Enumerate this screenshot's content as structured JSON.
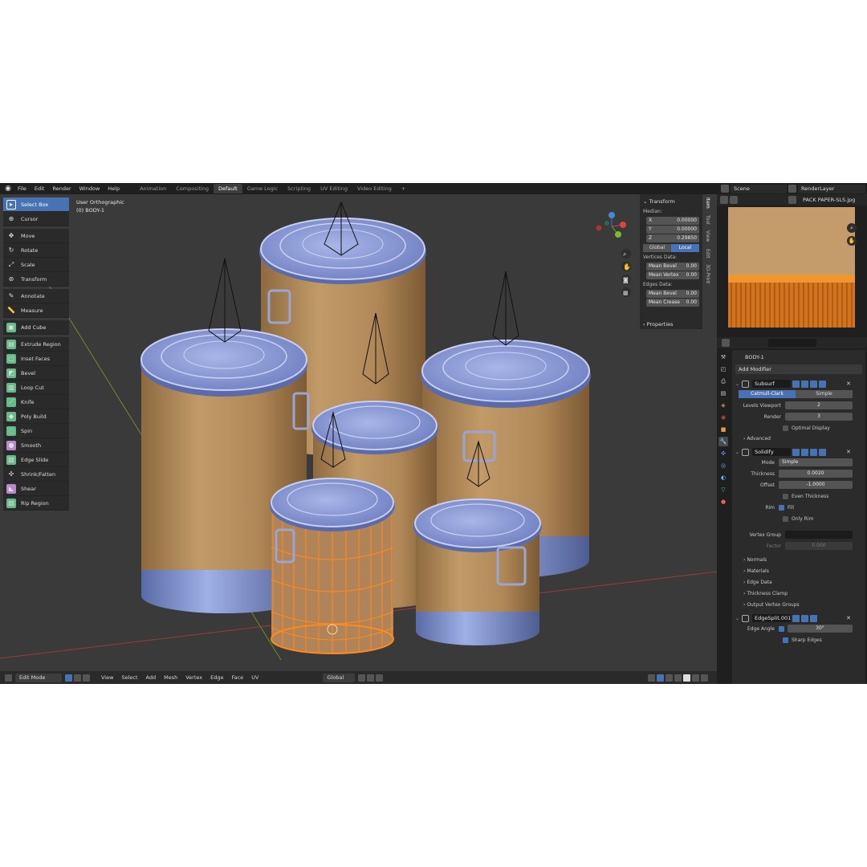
{
  "menu": [
    "File",
    "Edit",
    "Render",
    "Window",
    "Help"
  ],
  "workspaces": [
    "Animation",
    "Compositing",
    "Default",
    "Game Logic",
    "Scripting",
    "UV Editing",
    "Video Editing",
    "+"
  ],
  "active_workspace": "Default",
  "scene": "Scene",
  "render_layer": "RenderLayer",
  "viewport": {
    "view_name": "User Orthographic",
    "object_info": "(0) BODY-1"
  },
  "tools": [
    "Select Box",
    "Cursor",
    "Move",
    "Rotate",
    "Scale",
    "Transform",
    "Annotate",
    "Measure",
    "Add Cube",
    "Extrude Region",
    "Inset Faces",
    "Bevel",
    "Loop Cut",
    "Knife",
    "Poly Build",
    "Spin",
    "Smooth",
    "Edge Slide",
    "Shrink/Fatten",
    "Shear",
    "Rip Region"
  ],
  "npanel": {
    "transform": "Transform",
    "median": "Median:",
    "x_label": "X",
    "x": "0.00000",
    "y_label": "Y",
    "y": "0.00000",
    "z_label": "Z",
    "z": "0.29850",
    "global": "Global",
    "local": "Local",
    "vertices_data": "Vertices Data:",
    "mean_bevel_label": "Mean Bevel",
    "mean_bevel": "0.00",
    "mean_vertex_label": "Mean Vertex",
    "mean_vertex": "0.00",
    "edges_data": "Edges Data:",
    "mean_bevel2_label": "Mean Bevel",
    "mean_bevel2": "0.00",
    "mean_crease_label": "Mean Crease",
    "mean_crease": "0.00",
    "properties": "Properties",
    "tabs": [
      "Item",
      "Tool",
      "View",
      "Edit",
      "3D-Print"
    ]
  },
  "header": {
    "mode": "Edit Mode",
    "menus": [
      "View",
      "Select",
      "Add",
      "Mesh",
      "Vertex",
      "Edge",
      "Face",
      "UV"
    ],
    "orientation": "Global"
  },
  "image_editor": {
    "image_name": "PACK PAPER-SLS.jpg"
  },
  "properties": {
    "object": "BODY-1",
    "add_modifier": "Add Modifier",
    "subsurf": {
      "name": "Subsurf",
      "catmull": "Catmull-Clark",
      "simple": "Simple",
      "levels_label": "Levels Viewport",
      "levels": "2",
      "render_label": "Render",
      "render": "3",
      "optimal": "Optimal Display",
      "advanced": "Advanced"
    },
    "solidify": {
      "name": "Solidify",
      "mode_label": "Mode",
      "mode": "Simple",
      "thickness_label": "Thickness",
      "thickness": "0.0020",
      "offset_label": "Offset",
      "offset": "-1.0000",
      "even": "Even Thickness",
      "rim_label": "Rim",
      "fill": "Fill",
      "only_rim": "Only Rim",
      "vgroup_label": "Vertex Group",
      "factor_label": "Factor",
      "factor": "0.000",
      "sections": [
        "Normals",
        "Materials",
        "Edge Data",
        "Thickness Clamp",
        "Output Vertex Groups"
      ]
    },
    "edgesplit": {
      "name": "EdgeSplit.001",
      "angle_label": "Edge Angle",
      "angle": "30°",
      "sharp": "Sharp Edges"
    }
  },
  "colors": {
    "accent": "#4772b3",
    "selection": "#ff8a1c",
    "lid": "#8797cf",
    "body": "#b0875a"
  }
}
